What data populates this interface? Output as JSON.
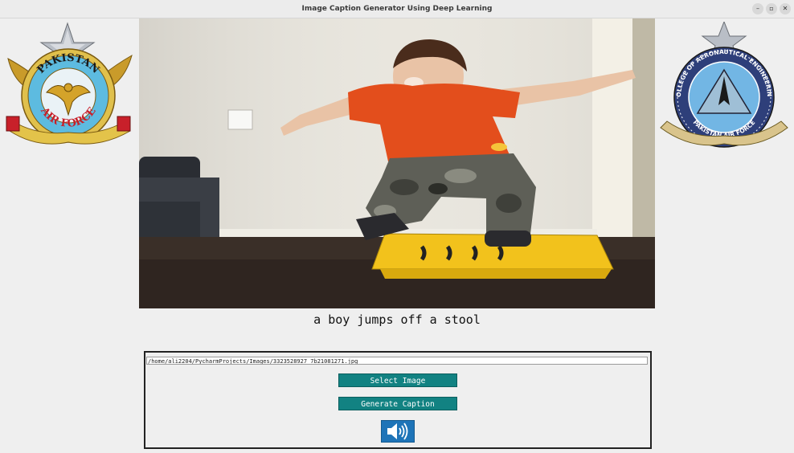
{
  "window": {
    "title": "Image Caption Generator Using Deep Learning"
  },
  "left_logo": {
    "top_text": "PAKISTAN",
    "bottom_text": "AIR FORCE"
  },
  "right_logo": {
    "ring_text": "COLLEGE OF AERONAUTICAL ENGINEERING",
    "bottom_text": "PAKISTAN AIR FORCE"
  },
  "main": {
    "caption": "a boy jumps off a stool"
  },
  "controls": {
    "file_path": "/home/ali2204/PycharmProjects/Images/3323528927_7b21081271.jpg",
    "select_label": "Select Image",
    "generate_label": "Generate Caption"
  },
  "colors": {
    "button_bg": "#128282",
    "speaker_bg": "#1e74b8"
  },
  "icons": [
    "minimize-icon",
    "maximize-icon",
    "close-icon",
    "speaker-icon"
  ]
}
